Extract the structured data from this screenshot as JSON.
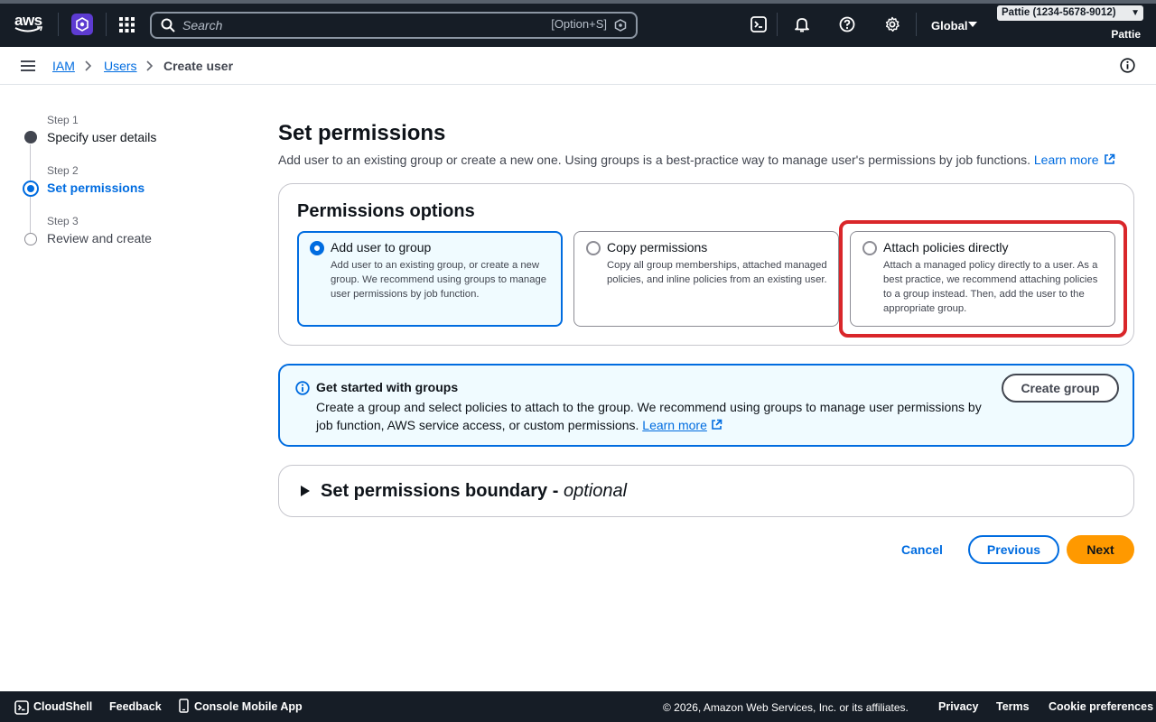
{
  "topnav": {
    "logo_text": "aws",
    "search_placeholder": "Search",
    "search_shortcut": "[Option+S]",
    "region": "Global",
    "account": "Pattie (1234-5678-9012)",
    "username": "Pattie"
  },
  "breadcrumb": {
    "items": [
      "IAM",
      "Users",
      "Create user"
    ]
  },
  "steps": [
    {
      "number": "Step 1",
      "label": "Specify user details",
      "state": "complete"
    },
    {
      "number": "Step 2",
      "label": "Set permissions",
      "state": "current"
    },
    {
      "number": "Step 3",
      "label": "Review and create",
      "state": "pending"
    }
  ],
  "main": {
    "title": "Set permissions",
    "description": "Add user to an existing group or create a new one. Using groups is a best-practice way to manage user's permissions by job functions.",
    "learn_more": "Learn more"
  },
  "permissions_options": {
    "title": "Permissions options",
    "options": [
      {
        "title": "Add user to group",
        "description": "Add user to an existing group, or create a new group. We recommend using groups to manage user permissions by job function.",
        "selected": true
      },
      {
        "title": "Copy permissions",
        "description": "Copy all group memberships, attached managed policies, and inline policies from an existing user.",
        "selected": false
      },
      {
        "title": "Attach policies directly",
        "description": "Attach a managed policy directly to a user. As a best practice, we recommend attaching policies to a group instead. Then, add the user to the appropriate group.",
        "selected": false
      }
    ]
  },
  "info_box": {
    "title": "Get started with groups",
    "body": "Create a group and select policies to attach to the group. We recommend using groups to manage user permissions by job function, AWS service access, or custom permissions.",
    "learn_more": "Learn more",
    "button": "Create group"
  },
  "boundary": {
    "title": "Set permissions boundary - ",
    "optional": "optional"
  },
  "actions": {
    "cancel": "Cancel",
    "previous": "Previous",
    "next": "Next"
  },
  "footer": {
    "cloudshell": "CloudShell",
    "feedback": "Feedback",
    "mobile_app": "Console Mobile App",
    "copyright": "© 2026, Amazon Web Services, Inc. or its affiliates.",
    "privacy": "Privacy",
    "terms": "Terms",
    "cookies": "Cookie preferences"
  },
  "colors": {
    "nav_bg": "#161d26",
    "link": "#006ce0",
    "primary": "#ff9900",
    "highlight": "#d9262a"
  }
}
